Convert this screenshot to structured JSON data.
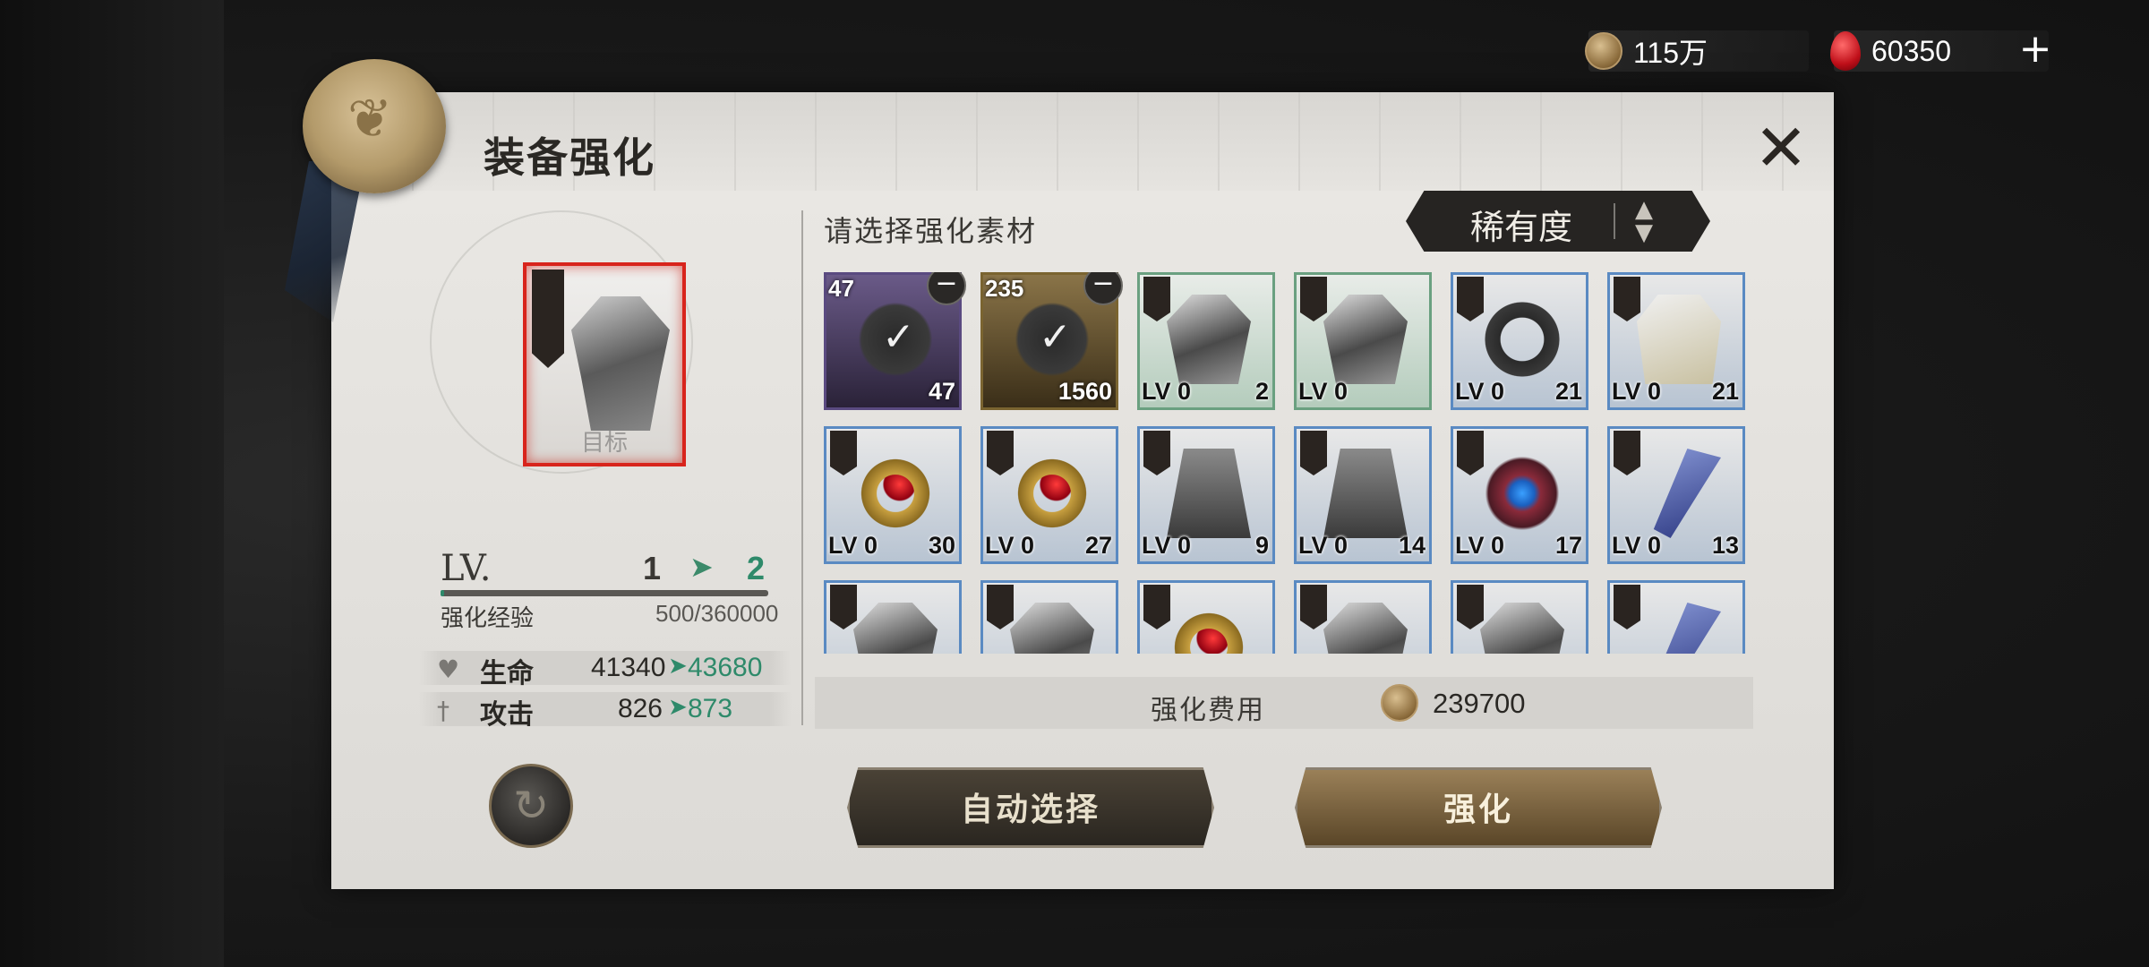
{
  "currency": {
    "coins": "115万",
    "gems": "60350",
    "add_icon": "+"
  },
  "dialog": {
    "title": "装备强化",
    "close_icon": "✕"
  },
  "target": {
    "label": "目标"
  },
  "level": {
    "label": "LV.",
    "current": "1",
    "arrow": "➤",
    "next": "2",
    "exp_label": "强化经验",
    "exp_value": "500/360000",
    "exp_progress": 0.0014
  },
  "stats": [
    {
      "icon": "heart-icon",
      "name": "生命",
      "current": "41340",
      "arrow": "➤",
      "new": "43680"
    },
    {
      "icon": "sword-icon",
      "name": "攻击",
      "current": "826",
      "arrow": "➤",
      "new": "873"
    }
  ],
  "materials": {
    "prompt": "请选择强化素材",
    "sort": {
      "label": "稀有度",
      "arrows": "▲\n▼"
    },
    "items": [
      {
        "rarity": "purple",
        "art": "mat",
        "top_count": "47",
        "minus": "−",
        "lv": "",
        "qty": "47"
      },
      {
        "rarity": "gold",
        "art": "mat",
        "top_count": "235",
        "minus": "−",
        "lv": "",
        "qty": "1560"
      },
      {
        "rarity": "green",
        "art": "armor",
        "lv": "LV 0",
        "qty": "2"
      },
      {
        "rarity": "green",
        "art": "armor",
        "lv": "LV 0",
        "qty": ""
      },
      {
        "rarity": "blue",
        "art": "scarf",
        "lv": "LV 0",
        "qty": "21"
      },
      {
        "rarity": "blue",
        "art": "coat",
        "lv": "LV 0",
        "qty": "21"
      },
      {
        "rarity": "blue",
        "art": "ring",
        "lv": "LV 0",
        "qty": "30"
      },
      {
        "rarity": "blue",
        "art": "ring",
        "lv": "LV 0",
        "qty": "27"
      },
      {
        "rarity": "blue",
        "art": "cape",
        "lv": "LV 0",
        "qty": "9"
      },
      {
        "rarity": "blue",
        "art": "cape",
        "lv": "LV 0",
        "qty": "14"
      },
      {
        "rarity": "blue",
        "art": "amulet",
        "lv": "LV 0",
        "qty": "17"
      },
      {
        "rarity": "blue",
        "art": "feather",
        "lv": "LV 0",
        "qty": "13"
      },
      {
        "rarity": "blue",
        "art": "armor",
        "lv": "",
        "qty": ""
      },
      {
        "rarity": "blue",
        "art": "armor",
        "lv": "",
        "qty": ""
      },
      {
        "rarity": "blue",
        "art": "ring",
        "lv": "",
        "qty": ""
      },
      {
        "rarity": "blue",
        "art": "armor",
        "lv": "",
        "qty": ""
      },
      {
        "rarity": "blue",
        "art": "armor",
        "lv": "",
        "qty": ""
      },
      {
        "rarity": "blue",
        "art": "feather",
        "lv": "",
        "qty": ""
      }
    ]
  },
  "cost": {
    "label": "强化费用",
    "value": "239700"
  },
  "buttons": {
    "reset_icon": "↻",
    "auto_select": "自动选择",
    "enhance": "强化"
  }
}
